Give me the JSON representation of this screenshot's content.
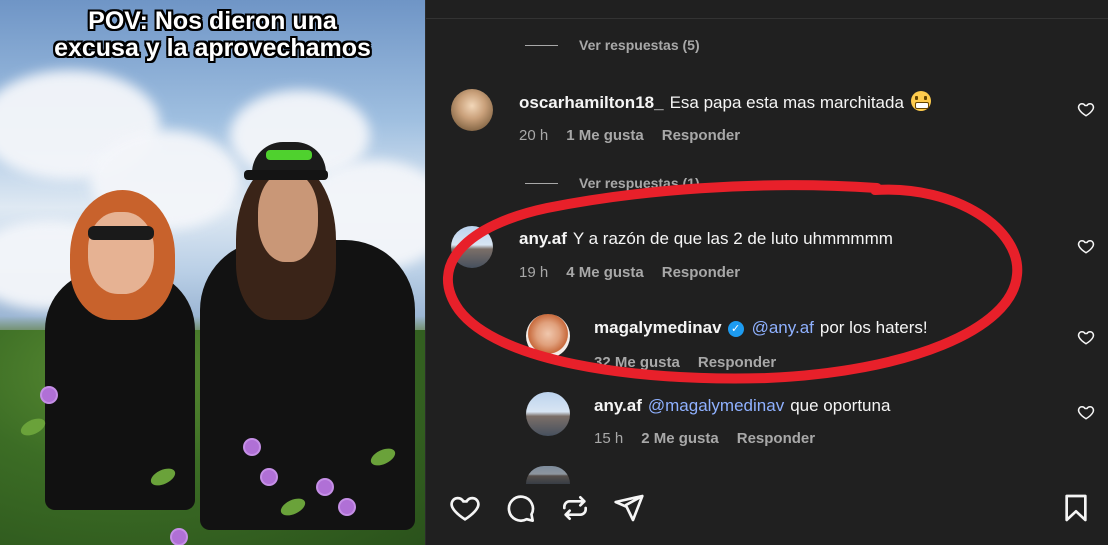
{
  "media": {
    "caption": "POV: Nos dieron una excusa y la aprovechamos"
  },
  "comments": {
    "view_replies_1": "Ver respuestas (5)",
    "view_replies_2": "Ver respuestas (1)",
    "items": [
      {
        "username": "oscarhamilton18_",
        "text": "Esa papa esta mas marchitada",
        "emoji": "grimacing-face",
        "time": "20 h",
        "likes": "1 Me gusta",
        "reply": "Responder"
      },
      {
        "username": "any.af",
        "text": "Y a razón de que las 2 de luto uhmmmmm",
        "time": "19 h",
        "likes": "4 Me gusta",
        "reply": "Responder"
      },
      {
        "username": "magalymedinav",
        "verified": true,
        "mention": "@any.af",
        "text": "por los haters!",
        "time": "",
        "likes": "32 Me gusta",
        "reply": "Responder"
      },
      {
        "username": "any.af",
        "mention": "@magalymedinav",
        "text": "que oportuna",
        "time": "15 h",
        "likes": "2 Me gusta",
        "reply": "Responder"
      }
    ]
  },
  "actions": {
    "icons": [
      "heart-icon",
      "comment-icon",
      "repost-icon",
      "share-icon",
      "bookmark-icon"
    ]
  },
  "colors": {
    "panel_bg": "#202020",
    "muted_text": "#a8a8a8",
    "mention": "#8fb1ff",
    "verified": "#1d9bf0",
    "annotation_red": "#e8202a"
  }
}
